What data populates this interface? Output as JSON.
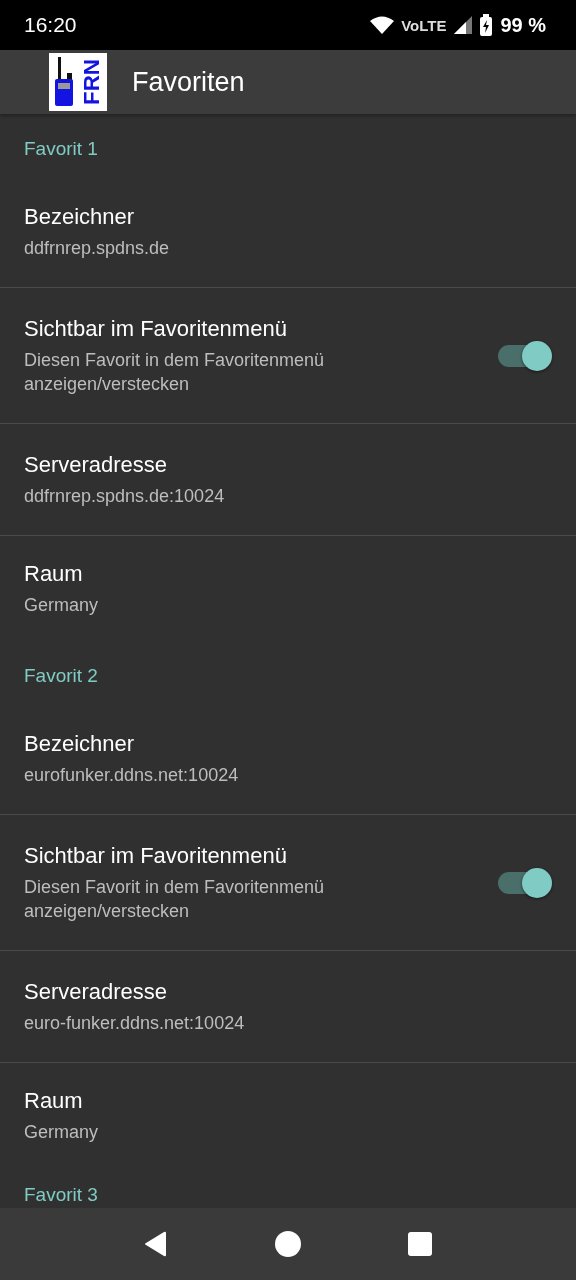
{
  "status_bar": {
    "time": "16:20",
    "network": "VoLTE",
    "battery": "99 %"
  },
  "app_bar": {
    "logo_text": "FRN",
    "title": "Favoriten"
  },
  "sections": [
    {
      "title": "Favorit 1",
      "items": [
        {
          "kind": "text",
          "title": "Bezeichner",
          "summary": "ddfrnrep.spdns.de"
        },
        {
          "kind": "switch",
          "title": "Sichtbar im Favoritenmenü",
          "summary": "Diesen Favorit in dem Favoritenmenü anzeigen/verstecken",
          "on": true
        },
        {
          "kind": "text",
          "title": "Serveradresse",
          "summary": "ddfrnrep.spdns.de:10024"
        },
        {
          "kind": "text",
          "title": "Raum",
          "summary": "Germany"
        }
      ]
    },
    {
      "title": "Favorit 2",
      "items": [
        {
          "kind": "text",
          "title": "Bezeichner",
          "summary": "eurofunker.ddns.net:10024"
        },
        {
          "kind": "switch",
          "title": "Sichtbar im Favoritenmenü",
          "summary": "Diesen Favorit in dem Favoritenmenü anzeigen/verstecken",
          "on": true
        },
        {
          "kind": "text",
          "title": "Serveradresse",
          "summary": "euro-funker.ddns.net:10024"
        },
        {
          "kind": "text",
          "title": "Raum",
          "summary": "Germany"
        }
      ]
    },
    {
      "title": "Favorit 3"
    }
  ]
}
